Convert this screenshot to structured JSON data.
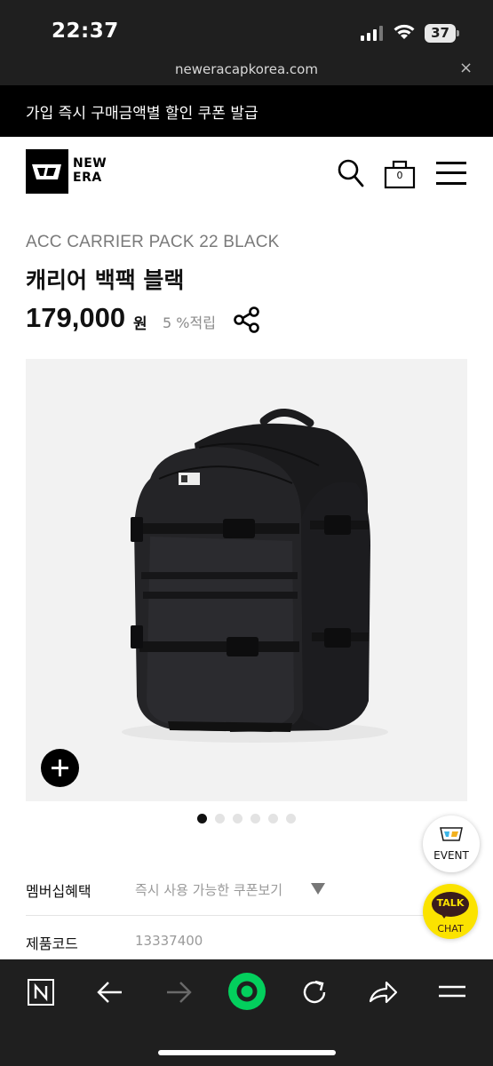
{
  "status_bar": {
    "time": "22:37",
    "battery": "37"
  },
  "browser": {
    "url": "neweracapkorea.com",
    "close_glyph": "×"
  },
  "promo_banner": {
    "text": "가입 즉시 구매금액별 할인 쿠폰 발급"
  },
  "header": {
    "logo_text_line1": "NEW",
    "logo_text_line2": "ERA",
    "bag_count": "0",
    "icons": [
      "search-icon",
      "shopping-bag-icon",
      "hamburger-menu-icon"
    ]
  },
  "product": {
    "code_name": "ACC CARRIER PACK 22 BLACK",
    "title": "캐리어 백팩 블랙",
    "price": "179,000",
    "price_unit": "원",
    "points": "5 %적립",
    "image_alt": "black backpack product photo",
    "carousel": {
      "total": 6,
      "active_index": 0
    }
  },
  "details": {
    "rows": [
      {
        "label": "멤버십혜택",
        "value": "즉시 사용 가능한 쿠폰보기"
      },
      {
        "label": "제품코드",
        "value": "13337400"
      }
    ]
  },
  "floating": {
    "event_label": "EVENT",
    "talk_label": "TALK",
    "chat_label": "CHAT"
  },
  "toolbar": {
    "icons": [
      "naver-home-icon",
      "back-arrow-icon",
      "forward-arrow-icon",
      "green-dot-icon",
      "reload-icon",
      "share-icon",
      "menu-icon"
    ]
  },
  "colors": {
    "promo_bg": "#000000",
    "browser_chrome": "#1f1f1f",
    "green_action": "#03cf5d",
    "kakao_yellow": "#fbe300"
  }
}
